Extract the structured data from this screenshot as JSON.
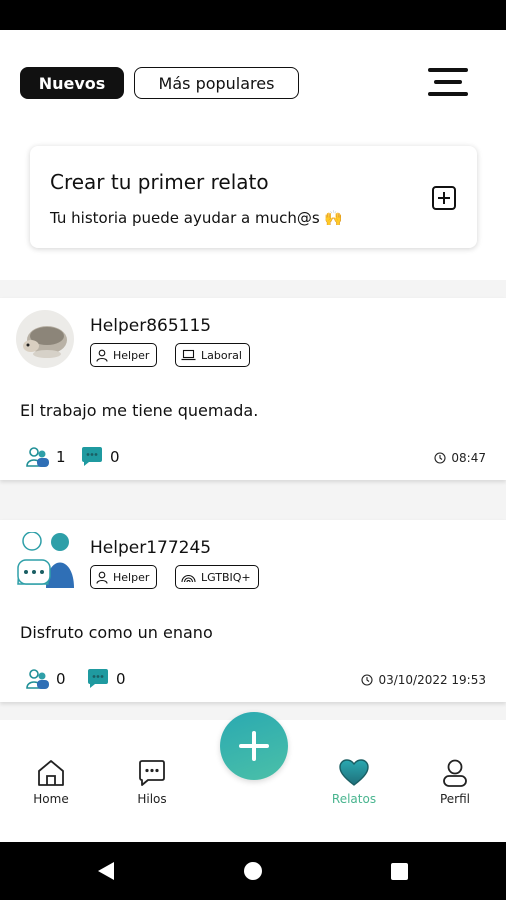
{
  "tabs": {
    "nuevos": "Nuevos",
    "populares": "Más populares"
  },
  "create_card": {
    "title": "Crear tu primer relato",
    "subtitle": "Tu historia puede ayudar a much@s 🙌"
  },
  "posts": [
    {
      "username": "Helper865115",
      "tags": [
        "Helper",
        "Laboral"
      ],
      "text": "El trabajo me tiene quemada.",
      "helpers": "1",
      "comments": "0",
      "time": "08:47"
    },
    {
      "username": "Helper177245",
      "tags": [
        "Helper",
        "LGTBIQ+"
      ],
      "text": "Disfruto como un enano",
      "helpers": "0",
      "comments": "0",
      "time": "03/10/2022 19:53"
    }
  ],
  "nav": {
    "home": "Home",
    "hilos": "Hilos",
    "relatos": "Relatos",
    "perfil": "Perfil"
  },
  "colors": {
    "accent": "#2aa9b1",
    "accent_green": "#4bc0a8",
    "active_label": "#49b58f",
    "chat_teal": "#1f8f96"
  }
}
